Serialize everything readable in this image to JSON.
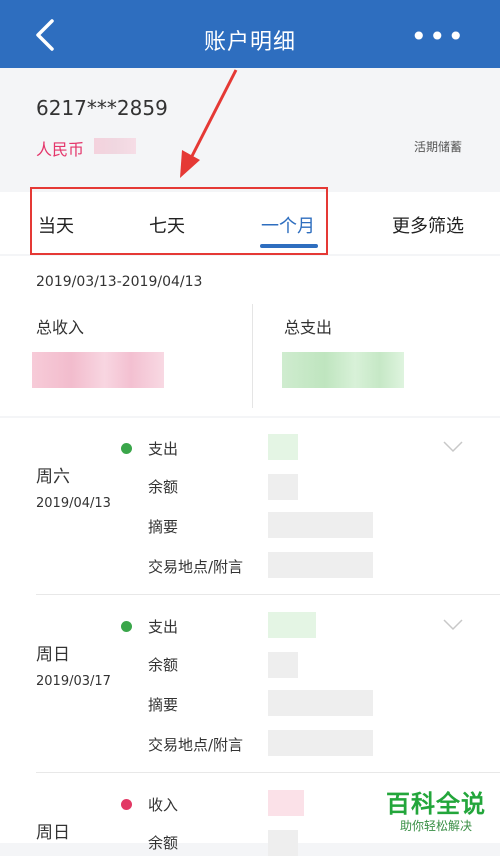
{
  "nav": {
    "title": "账户明细",
    "more": "•••"
  },
  "account": {
    "number": "6217***2859",
    "currency": "人民币",
    "type": "活期储蓄"
  },
  "tabs": [
    "当天",
    "七天",
    "一个月",
    "更多筛选"
  ],
  "active_tab": "一个月",
  "summary": {
    "range": "2019/03/13-2019/04/13",
    "income_label": "总收入",
    "expense_label": "总支出"
  },
  "transactions": [
    {
      "weekday": "周六",
      "date": "2019/04/13",
      "type": "支出",
      "fields": [
        "余额",
        "摘要",
        "交易地点/附言"
      ]
    },
    {
      "weekday": "周日",
      "date": "2019/03/17",
      "type": "支出",
      "fields": [
        "余额",
        "摘要",
        "交易地点/附言"
      ]
    },
    {
      "weekday": "周日",
      "type": "收入",
      "fields": [
        "余额"
      ]
    }
  ],
  "watermark": {
    "title": "百科全说",
    "subtitle": "助你轻松解决"
  },
  "colors": {
    "header": "#2e6ebf",
    "accent": "#2e6ebf",
    "annotation": "#e53935",
    "expense_dot": "#3aa64a",
    "income_dot": "#e23864"
  }
}
